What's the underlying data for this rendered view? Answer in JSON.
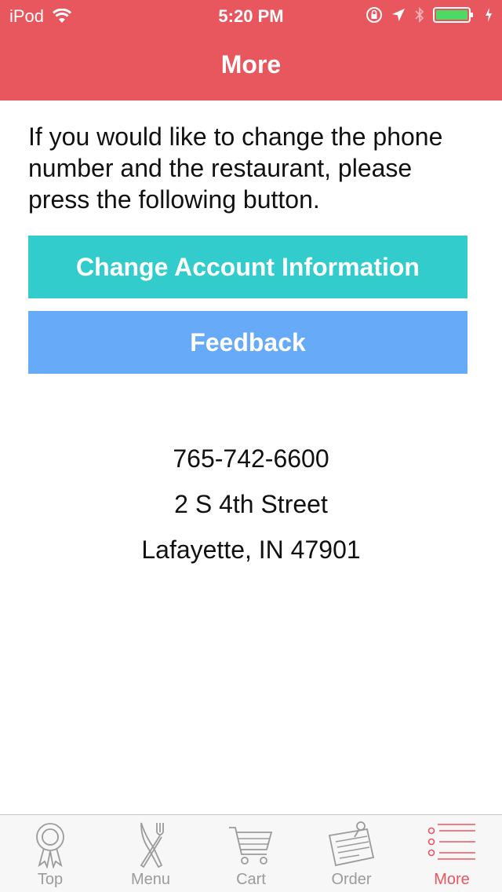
{
  "status_bar": {
    "carrier": "iPod",
    "time": "5:20 PM"
  },
  "nav": {
    "title": "More"
  },
  "intro_text": "If you would like to change the phone number and the restaurant, please press the following button.",
  "buttons": {
    "change_account": "Change Account Information",
    "feedback": "Feedback"
  },
  "restaurant": {
    "phone": "765-742-6600",
    "street": "2 S 4th Street",
    "city": "Lafayette, IN 47901"
  },
  "tabs": [
    {
      "label": "Top",
      "icon": "ribbon-award-icon"
    },
    {
      "label": "Menu",
      "icon": "fork-knife-icon"
    },
    {
      "label": "Cart",
      "icon": "cart-icon"
    },
    {
      "label": "Order",
      "icon": "clipboard-pin-icon"
    },
    {
      "label": "More",
      "icon": "list-icon",
      "active": true
    }
  ],
  "colors": {
    "nav_background": "#e8565e",
    "change_account_button": "#33cccc",
    "feedback_button": "#66aaf8",
    "tab_active": "#e8565e",
    "tab_inactive": "#9b9b9b"
  }
}
